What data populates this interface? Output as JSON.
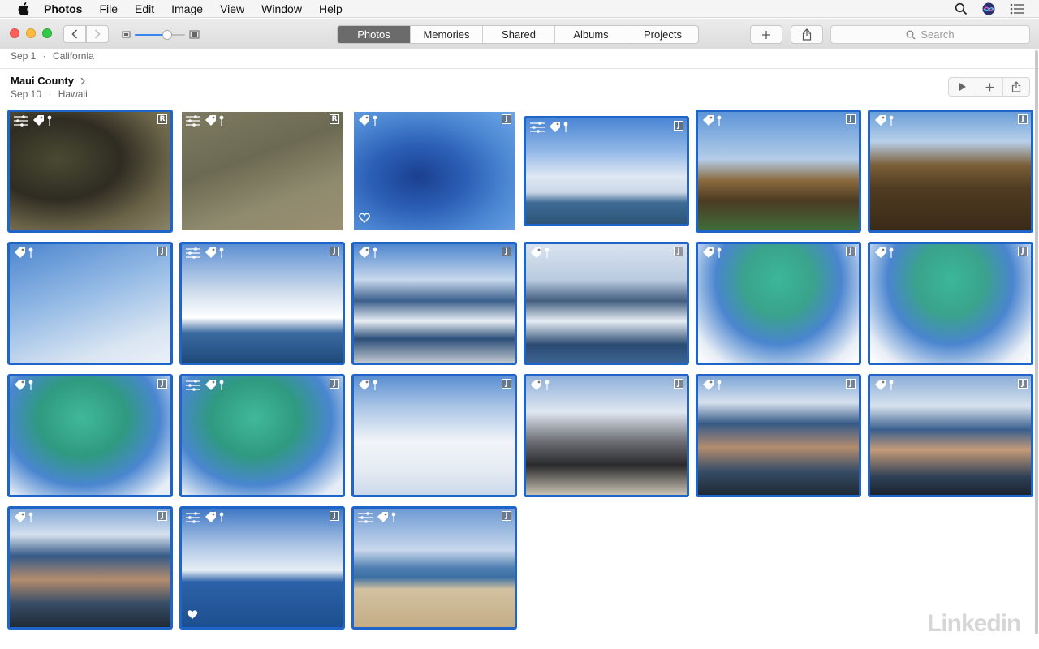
{
  "menubar": {
    "app_name": "Photos",
    "items": [
      "File",
      "Edit",
      "Image",
      "View",
      "Window",
      "Help"
    ],
    "icons": [
      "apple-icon",
      "search-icon",
      "siri-icon",
      "notification-center-icon"
    ]
  },
  "toolbar": {
    "tabs": [
      "Photos",
      "Memories",
      "Shared",
      "Albums",
      "Projects"
    ],
    "active_tab": "Photos",
    "search_placeholder": "Search",
    "icons": [
      "back-icon",
      "forward-icon",
      "zoom-small-icon",
      "zoom-large-icon",
      "add-icon",
      "share-icon",
      "search-icon"
    ],
    "zoom_level": 0.5
  },
  "previous_moment": {
    "date": "Sep 1",
    "separator": "·",
    "location": "California"
  },
  "moment": {
    "title": "Maui County",
    "date": "Sep 10",
    "separator": "·",
    "location": "Hawaii",
    "actions": [
      "play-icon",
      "add-icon",
      "share-icon"
    ]
  },
  "photos": [
    {
      "bg": "bg-reef1",
      "selected": true,
      "adjusted": true,
      "keyword": true,
      "location": true,
      "badge": "R",
      "favorite": false
    },
    {
      "bg": "bg-reef2",
      "selected": false,
      "adjusted": true,
      "keyword": true,
      "location": true,
      "badge": "R",
      "favorite": false
    },
    {
      "bg": "bg-reef3",
      "selected": false,
      "adjusted": false,
      "keyword": true,
      "location": true,
      "badge": "J",
      "favorite": true
    },
    {
      "bg": "bg-clouds",
      "selected": true,
      "adjusted": true,
      "keyword": true,
      "location": true,
      "badge": "J",
      "favorite": false
    },
    {
      "bg": "bg-palm",
      "selected": true,
      "adjusted": false,
      "keyword": true,
      "location": true,
      "badge": "J",
      "favorite": false
    },
    {
      "bg": "bg-palm2",
      "selected": true,
      "adjusted": false,
      "keyword": true,
      "location": true,
      "badge": "J",
      "favorite": false
    },
    {
      "bg": "bg-sky",
      "selected": true,
      "adjusted": false,
      "keyword": true,
      "location": true,
      "badge": "J",
      "favorite": false
    },
    {
      "bg": "bg-sea",
      "selected": true,
      "adjusted": true,
      "keyword": true,
      "location": true,
      "badge": "J",
      "favorite": false
    },
    {
      "bg": "bg-boat",
      "selected": true,
      "adjusted": false,
      "keyword": true,
      "location": true,
      "badge": "J",
      "favorite": false
    },
    {
      "bg": "bg-wake",
      "selected": true,
      "adjusted": false,
      "keyword": true,
      "location": true,
      "badge": "J",
      "favorite": false
    },
    {
      "bg": "bg-chute",
      "selected": true,
      "adjusted": false,
      "keyword": true,
      "location": true,
      "badge": "J",
      "favorite": false
    },
    {
      "bg": "bg-chute",
      "selected": true,
      "adjusted": false,
      "keyword": true,
      "location": true,
      "badge": "J",
      "favorite": false
    },
    {
      "bg": "bg-chute2",
      "selected": true,
      "adjusted": false,
      "keyword": true,
      "location": true,
      "badge": "J",
      "favorite": false
    },
    {
      "bg": "bg-chute2",
      "selected": true,
      "adjusted": true,
      "keyword": true,
      "location": true,
      "badge": "J",
      "favorite": false
    },
    {
      "bg": "bg-rider",
      "selected": true,
      "adjusted": false,
      "keyword": true,
      "location": true,
      "badge": "J",
      "favorite": false
    },
    {
      "bg": "bg-boat2",
      "selected": true,
      "adjusted": false,
      "keyword": true,
      "location": true,
      "badge": "J",
      "favorite": false
    },
    {
      "bg": "bg-guys",
      "selected": true,
      "adjusted": false,
      "keyword": true,
      "location": true,
      "badge": "J",
      "favorite": false
    },
    {
      "bg": "bg-guys2",
      "selected": true,
      "adjusted": false,
      "keyword": true,
      "location": true,
      "badge": "J",
      "favorite": false
    },
    {
      "bg": "bg-guys",
      "selected": true,
      "adjusted": false,
      "keyword": true,
      "location": true,
      "badge": "J",
      "favorite": false
    },
    {
      "bg": "bg-ocean",
      "selected": true,
      "adjusted": true,
      "keyword": true,
      "location": true,
      "badge": "J",
      "favorite": true
    },
    {
      "bg": "bg-beach",
      "selected": true,
      "adjusted": true,
      "keyword": true,
      "location": true,
      "badge": "J",
      "favorite": false
    }
  ],
  "watermark": "Linkedin",
  "colors": {
    "selection": "#1f64c8",
    "active_tab": "#6b6b6b"
  }
}
